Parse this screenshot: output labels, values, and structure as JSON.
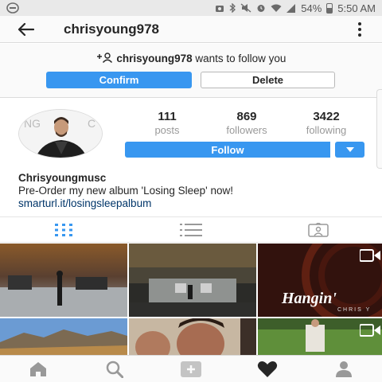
{
  "status": {
    "battery": "54%",
    "time": "5:50 AM"
  },
  "header": {
    "title": "chrisyoung978"
  },
  "request": {
    "username": "chrisyoung978",
    "message": "wants to follow you",
    "confirm_label": "Confirm",
    "delete_label": "Delete"
  },
  "profile": {
    "posts_count": "111",
    "posts_label": "posts",
    "followers_count": "869",
    "followers_label": "followers",
    "following_count": "3422",
    "following_label": "following",
    "follow_label": "Follow"
  },
  "bio": {
    "name": "Chrisyoungmusc",
    "text": "Pre-Order my new album 'Losing Sleep' now!",
    "link": "smarturl.it/losingsleepalbum"
  },
  "grid": {
    "overlay_title": "Hangin'",
    "overlay_sub": "CHRIS Y"
  },
  "colors": {
    "accent": "#3897f0",
    "link": "#003569"
  },
  "icons": {
    "back": "back-arrow-icon",
    "more": "more-vertical-icon",
    "follow_request": "add-person-icon",
    "grid_tab": "grid-icon",
    "list_tab": "list-icon",
    "tagged_tab": "tagged-icon",
    "home": "home-icon",
    "search": "search-icon",
    "add": "add-post-icon",
    "activity": "heart-icon",
    "profile": "person-icon"
  }
}
